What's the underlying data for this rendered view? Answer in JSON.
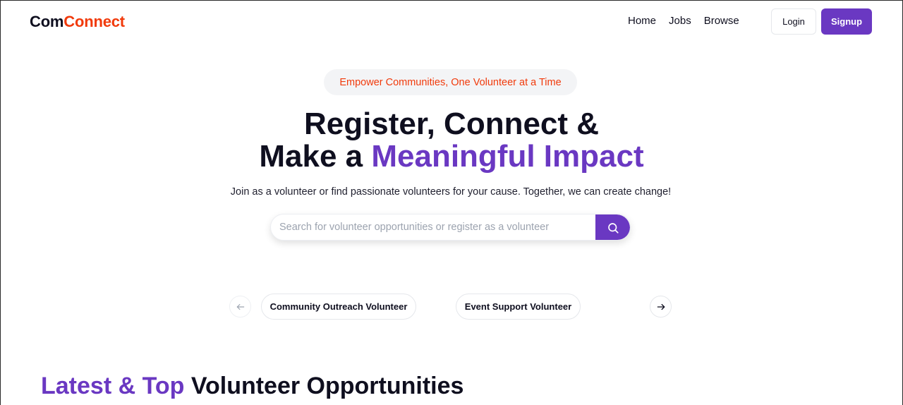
{
  "brand": {
    "name_part1": "Com",
    "name_part2": "Connect",
    "color_part1": "#0f0f1f",
    "color_part2": "#f13a0b"
  },
  "nav": {
    "links": [
      {
        "label": "Home"
      },
      {
        "label": "Jobs"
      },
      {
        "label": "Browse"
      }
    ],
    "login_label": "Login",
    "signup_label": "Signup"
  },
  "hero": {
    "tagline": "Empower Communities, One Volunteer at a Time",
    "title_line1": "Register, Connect &",
    "title_line2_prefix": "Make a ",
    "title_line2_highlight": "Meaningful Impact",
    "subtitle": "Join as a volunteer or find passionate volunteers for your cause. Together, we can create change!"
  },
  "search": {
    "placeholder": "Search for volunteer opportunities or register as a volunteer",
    "value": "",
    "button_icon": "search-icon"
  },
  "carousel": {
    "prev_icon": "arrow-left-icon",
    "next_icon": "arrow-right-icon",
    "items": [
      {
        "label": "Community Outreach Volunteer"
      },
      {
        "label": "Event Support Volunteer"
      }
    ]
  },
  "section": {
    "title_highlight": "Latest & Top",
    "title_rest": " Volunteer Opportunities"
  },
  "colors": {
    "accent": "#6a38c2",
    "brand_orange": "#f13a0b",
    "text_dark": "#0f0f1f"
  }
}
